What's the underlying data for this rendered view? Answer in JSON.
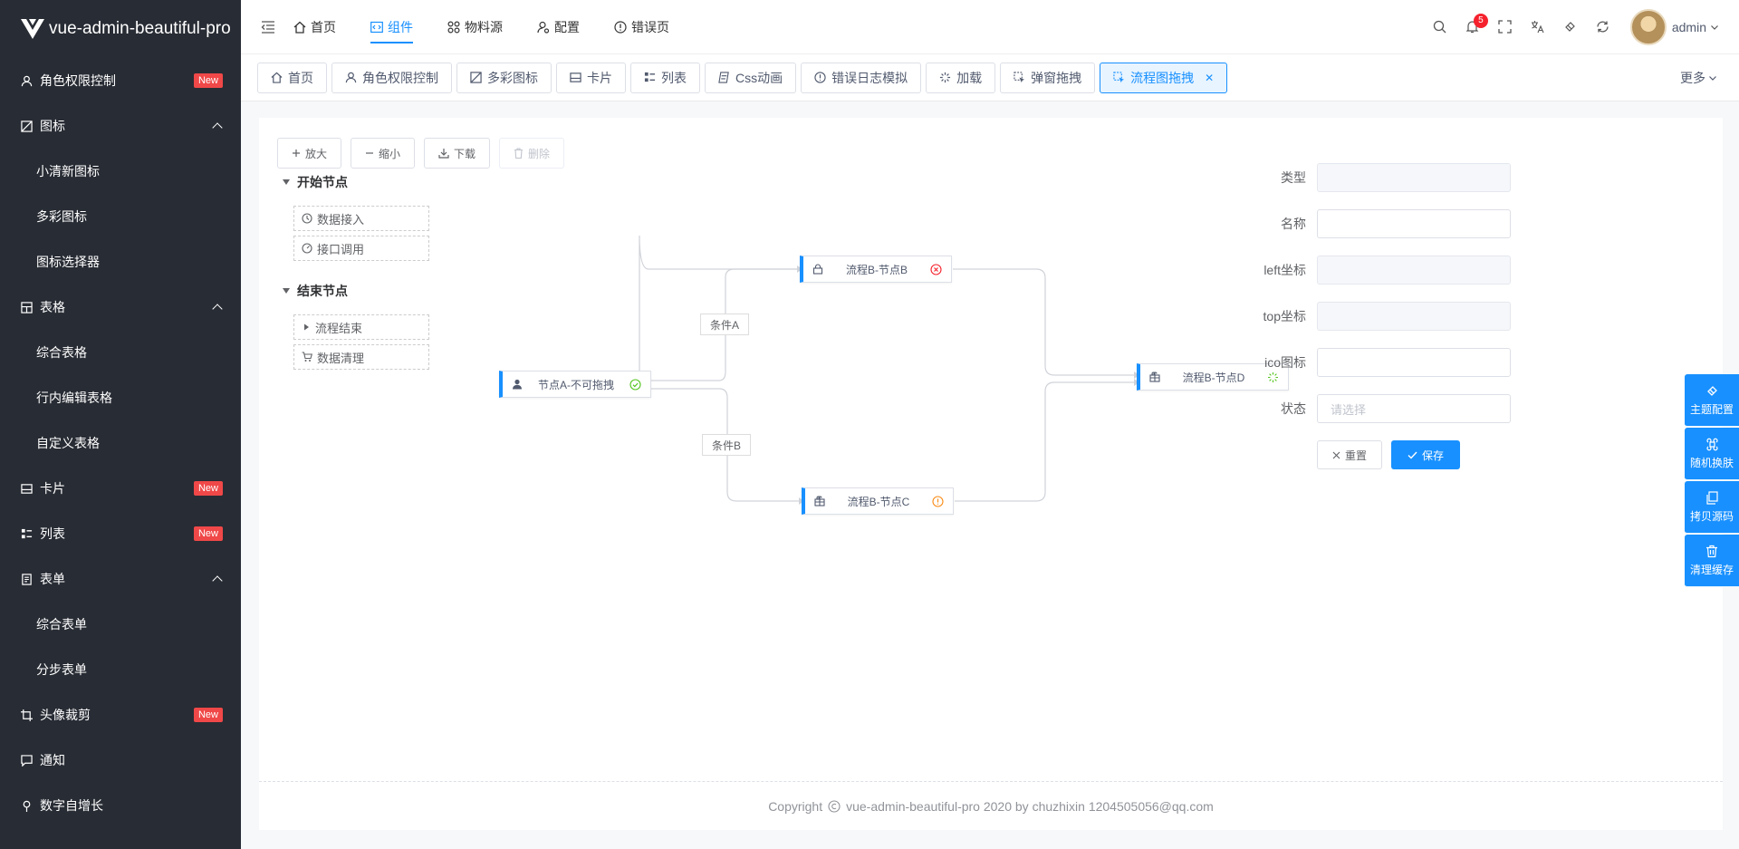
{
  "app": {
    "title": "vue-admin-beautiful-pro"
  },
  "sidebar": {
    "items": [
      {
        "label": "角色权限控制",
        "icon": "user-icon",
        "badge": "New"
      },
      {
        "label": "图标",
        "icon": "image-icon",
        "expanded": true
      },
      {
        "label": "小清新图标",
        "sub": true
      },
      {
        "label": "多彩图标",
        "sub": true
      },
      {
        "label": "图标选择器",
        "sub": true
      },
      {
        "label": "表格",
        "icon": "table-icon",
        "expanded": true
      },
      {
        "label": "综合表格",
        "sub": true
      },
      {
        "label": "行内编辑表格",
        "sub": true
      },
      {
        "label": "自定义表格",
        "sub": true
      },
      {
        "label": "卡片",
        "icon": "card-icon",
        "badge": "New"
      },
      {
        "label": "列表",
        "icon": "list-icon",
        "badge": "New"
      },
      {
        "label": "表单",
        "icon": "form-icon",
        "expanded": true
      },
      {
        "label": "综合表单",
        "sub": true
      },
      {
        "label": "分步表单",
        "sub": true
      },
      {
        "label": "头像裁剪",
        "icon": "crop-icon",
        "badge": "New"
      },
      {
        "label": "通知",
        "icon": "message-icon"
      },
      {
        "label": "数字自增长",
        "icon": "pin-icon"
      }
    ]
  },
  "header": {
    "nav": [
      {
        "label": "首页",
        "icon": "home-icon"
      },
      {
        "label": "组件",
        "icon": "code-icon",
        "active": true
      },
      {
        "label": "物料源",
        "icon": "apps-icon"
      },
      {
        "label": "配置",
        "icon": "user-settings-icon"
      },
      {
        "label": "错误页",
        "icon": "error-icon"
      }
    ],
    "notifications": "5",
    "username": "admin"
  },
  "tabs": {
    "items": [
      {
        "label": "首页",
        "icon": "home-icon"
      },
      {
        "label": "角色权限控制",
        "icon": "user-icon"
      },
      {
        "label": "多彩图标",
        "icon": "image-icon"
      },
      {
        "label": "卡片",
        "icon": "card-icon"
      },
      {
        "label": "列表",
        "icon": "list-icon"
      },
      {
        "label": "Css动画",
        "icon": "css-icon"
      },
      {
        "label": "错误日志模拟",
        "icon": "error-icon"
      },
      {
        "label": "加载",
        "icon": "loading-icon"
      },
      {
        "label": "弹窗拖拽",
        "icon": "drag-icon"
      },
      {
        "label": "流程图拖拽",
        "icon": "flow-icon",
        "active": true
      }
    ],
    "more": "更多"
  },
  "toolbar": {
    "zoom_in": "放大",
    "zoom_out": "缩小",
    "download": "下载",
    "delete": "删除"
  },
  "tree": {
    "start_group": "开始节点",
    "start_nodes": [
      "数据接入",
      "接口调用"
    ],
    "end_group": "结束节点",
    "end_nodes": [
      "流程结束",
      "数据清理"
    ]
  },
  "flow": {
    "nodes": {
      "a": "节点A-不可拖拽",
      "b": "流程B-节点B",
      "c": "流程B-节点C",
      "d": "流程B-节点D"
    },
    "conditions": {
      "a": "条件A",
      "b": "条件B"
    }
  },
  "form": {
    "type_label": "类型",
    "name_label": "名称",
    "left_label": "left坐标",
    "top_label": "top坐标",
    "ico_label": "ico图标",
    "state_label": "状态",
    "state_placeholder": "请选择",
    "reset": "重置",
    "save": "保存"
  },
  "float_panel": [
    "主题配置",
    "随机换肤",
    "拷贝源码",
    "清理缓存"
  ],
  "footer": {
    "prefix": "Copyright",
    "text": "vue-admin-beautiful-pro 2020 by chuzhixin 1204505056@qq.com"
  },
  "colors": {
    "primary": "#1890ff",
    "sidebar_bg": "#282c34",
    "badge_red": "#f04848"
  }
}
